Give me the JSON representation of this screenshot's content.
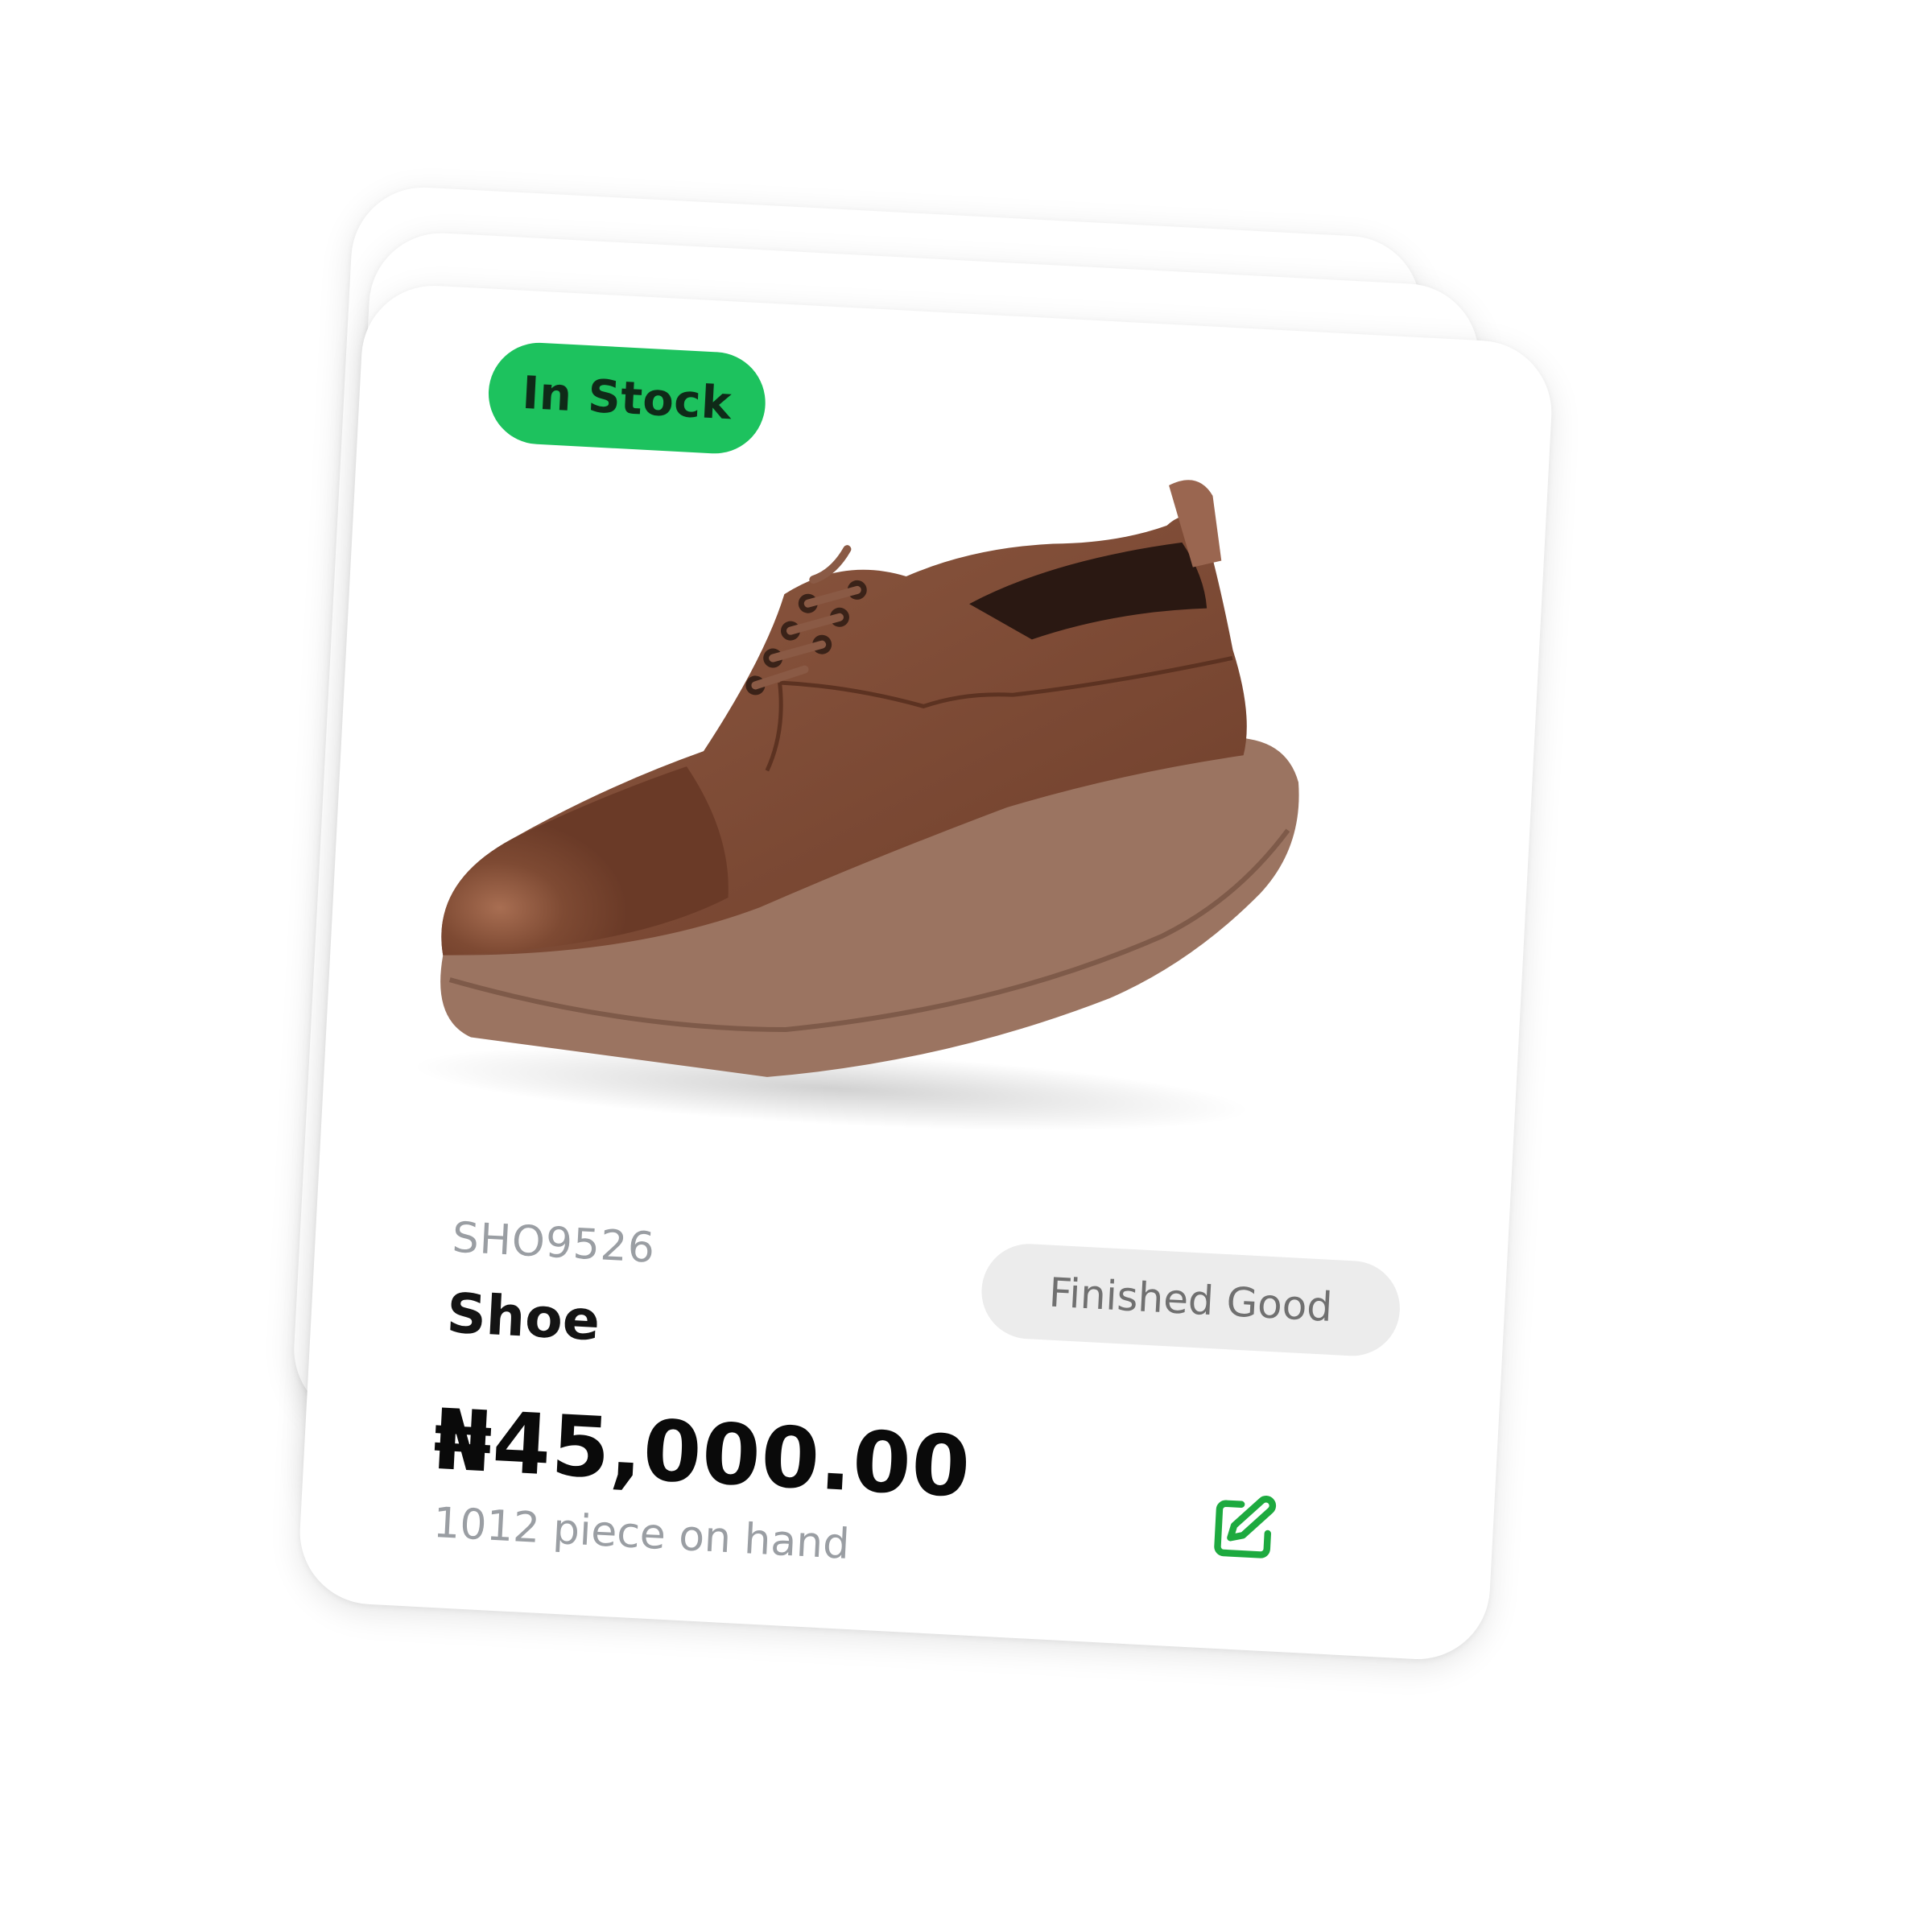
{
  "product": {
    "stock_status": "In Stock",
    "sku": "SHO9526",
    "name": "Shoe",
    "category": "Finished Good",
    "price": "₦45,000.00",
    "on_hand": "1012 piece on hand",
    "image": "brown-leather-derby-shoe"
  },
  "actions": {
    "edit_icon": "edit-pencil-square-icon"
  },
  "colors": {
    "stock_badge": "#1DC25E",
    "edit_icon": "#1DAA3F",
    "card_background": "#FFFFFF",
    "category_badge": "#ECECEC",
    "shoe_leather": "#7A4632",
    "shoe_sole": "#9B7461"
  }
}
